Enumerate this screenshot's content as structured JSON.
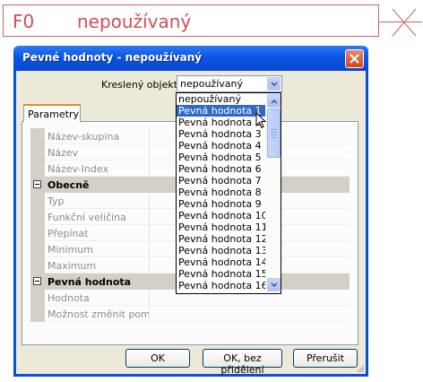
{
  "background": {
    "code": "F0",
    "name": "nepoužívaný"
  },
  "dialog": {
    "title": "Pevné hodnoty - nepoužívaný",
    "object_label": "Kreslený objekt:",
    "object_value": "nepoužívaný",
    "tab": "Parametry",
    "rows": [
      {
        "type": "prop",
        "label": "Název-skupina"
      },
      {
        "type": "prop",
        "label": "Název"
      },
      {
        "type": "prop",
        "label": "Název-Index"
      },
      {
        "type": "cat",
        "label": "Obecně"
      },
      {
        "type": "prop",
        "label": "Typ"
      },
      {
        "type": "prop",
        "label": "Funkční veličina"
      },
      {
        "type": "prop",
        "label": "Přepínat"
      },
      {
        "type": "prop",
        "label": "Minimum"
      },
      {
        "type": "prop",
        "label": "Maximum"
      },
      {
        "type": "cat",
        "label": "Pevná hodnota"
      },
      {
        "type": "prop",
        "label": "Hodnota"
      },
      {
        "type": "prop",
        "label": "Možnost změnit pomocí"
      }
    ],
    "buttons": {
      "ok": "OK",
      "ok_no_assign": "OK, bez přidělení",
      "cancel": "Přerušit"
    }
  },
  "dropdown": {
    "selected_index": 1,
    "items": [
      "nepoužívaný",
      "Pevná hodnota 1",
      "Pevná hodnota 2",
      "Pevná hodnota 3",
      "Pevná hodnota 4",
      "Pevná hodnota 5",
      "Pevná hodnota 6",
      "Pevná hodnota 7",
      "Pevná hodnota 8",
      "Pevná hodnota 9",
      "Pevná hodnota 10",
      "Pevná hodnota 11",
      "Pevná hodnota 12",
      "Pevná hodnota 13",
      "Pevná hodnota 14",
      "Pevná hodnota 15",
      "Pevná hodnota 16"
    ]
  },
  "colors": {
    "title_bar": "#0b55e3",
    "selection": "#316ac5",
    "background_label": "#d05050"
  },
  "icons": [
    "close-icon",
    "chevron-down-icon",
    "chevron-up-icon",
    "collapse-icon",
    "resize-grip-icon",
    "mouse-cursor-icon"
  ]
}
